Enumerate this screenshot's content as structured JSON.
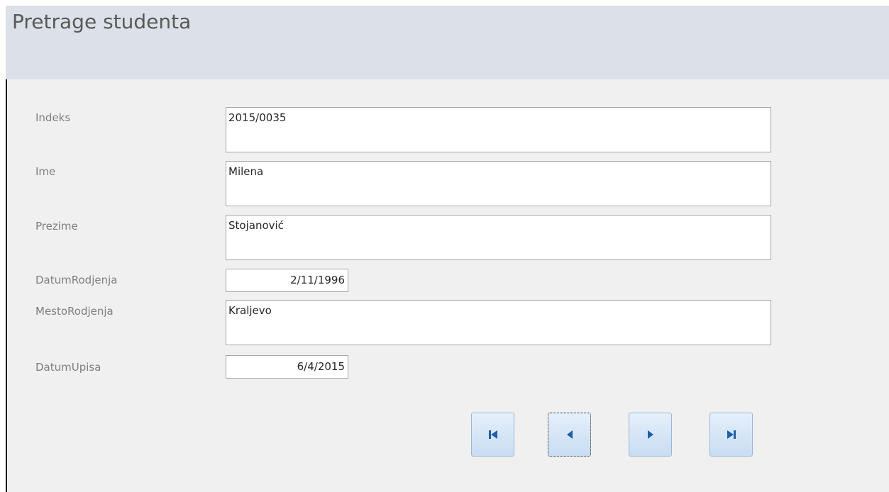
{
  "form": {
    "title": "Pretrage studenta",
    "fields": {
      "indeks": {
        "label": "Indeks",
        "value": "2015/0035"
      },
      "ime": {
        "label": "Ime",
        "value": "Milena"
      },
      "prezime": {
        "label": "Prezime",
        "value": "Stojanović"
      },
      "datum_rodjenja": {
        "label": "DatumRodjenja",
        "value": "2/11/1996"
      },
      "mesto_rodjenja": {
        "label": "MestoRodjenja",
        "value": "Kraljevo"
      },
      "datum_upisa": {
        "label": "DatumUpisa",
        "value": "6/4/2015"
      }
    },
    "navigation": {
      "buttons": [
        {
          "icon": "first-record-icon"
        },
        {
          "icon": "previous-record-icon"
        },
        {
          "icon": "next-record-icon"
        },
        {
          "icon": "last-record-icon"
        }
      ],
      "focused": "previous-record-button"
    }
  },
  "colors": {
    "header_bg": "#dce1e9",
    "form_bg": "#f0f0f0",
    "label_text": "#7f7f7f",
    "field_border": "#a6a6a6",
    "nav_icon": "#1f5fa8"
  }
}
